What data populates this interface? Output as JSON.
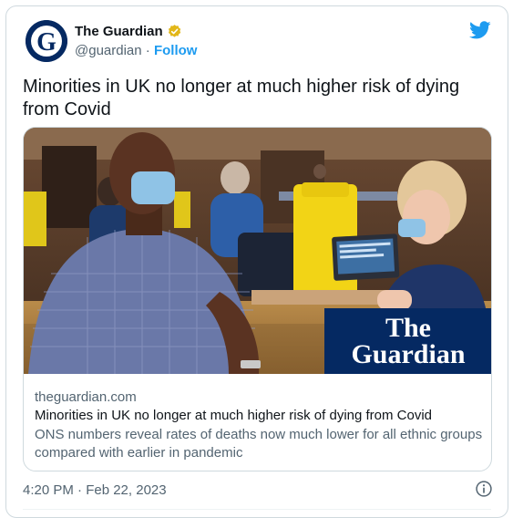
{
  "account": {
    "display_name": "The Guardian",
    "handle": "@guardian",
    "separator": "·",
    "follow_label": "Follow",
    "avatar_letter": "G"
  },
  "tweet": {
    "text": "Minorities in UK no longer at much higher risk of dying from Covid"
  },
  "link_card": {
    "domain": "theguardian.com",
    "title": "Minorities in UK no longer at much higher risk of dying from Covid",
    "description": "ONS numbers reveal rates of deaths now much lower for all ethnic groups compared with earlier in pandemic",
    "logo_line1": "The",
    "logo_line2": "Guardian"
  },
  "footer": {
    "timestamp": "4:20 PM · Feb 22, 2023"
  },
  "colors": {
    "guardian_blue": "#052962",
    "twitter_blue": "#1d9bf0",
    "verified_gold": "#e2b719"
  },
  "icons": [
    "guardian-avatar-logo",
    "verified-badge-icon",
    "twitter-bird-icon",
    "info-icon"
  ]
}
